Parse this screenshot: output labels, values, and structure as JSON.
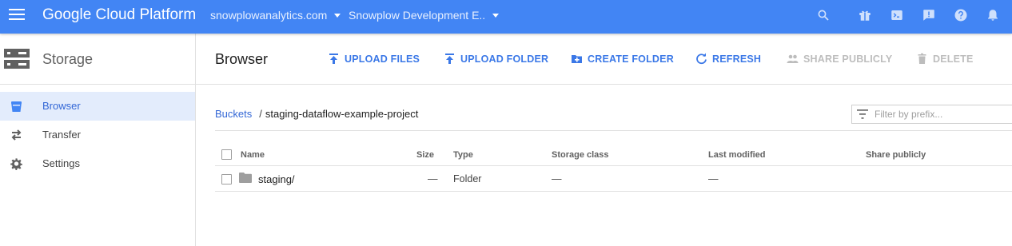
{
  "topbar": {
    "brand": "Google Cloud Platform",
    "org_select": "snowplowanalytics.com",
    "project_select": "Snowplow Development E..",
    "icons": [
      "search-icon",
      "gift-icon",
      "cloud-shell-icon",
      "feedback-icon",
      "help-icon",
      "notifications-icon"
    ],
    "background": "#4285f4"
  },
  "sidebar": {
    "title": "Storage",
    "items": [
      {
        "label": "Browser",
        "icon": "bucket-icon",
        "active": true
      },
      {
        "label": "Transfer",
        "icon": "transfer-icon",
        "active": false
      },
      {
        "label": "Settings",
        "icon": "gear-icon",
        "active": false
      }
    ]
  },
  "main": {
    "title": "Browser",
    "actions": {
      "upload_files": "UPLOAD FILES",
      "upload_folder": "UPLOAD FOLDER",
      "create_folder": "CREATE FOLDER",
      "refresh": "REFRESH",
      "share_publicly": "SHARE PUBLICLY",
      "delete": "DELETE"
    },
    "breadcrumb": {
      "root": "Buckets",
      "separator": "/",
      "current": "staging-dataflow-example-project"
    },
    "filter": {
      "placeholder": "Filter by prefix...",
      "value": ""
    },
    "table": {
      "columns": [
        "Name",
        "Size",
        "Type",
        "Storage class",
        "Last modified",
        "Share publicly"
      ],
      "rows": [
        {
          "name": "staging/",
          "size": "—",
          "type": "Folder",
          "storage_class": "—",
          "last_modified": "—",
          "share_publicly": ""
        }
      ]
    },
    "accent": "#3b78e7",
    "disabled_color": "#bdbdbd"
  }
}
